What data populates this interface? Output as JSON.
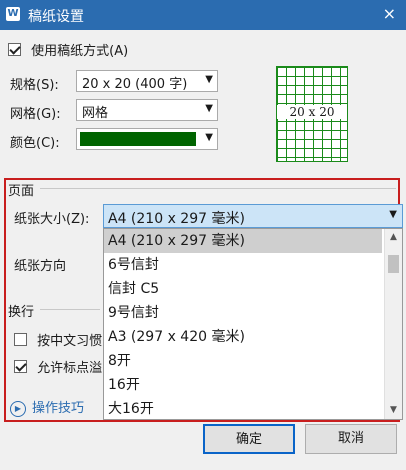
{
  "window": {
    "title": "稿纸设置",
    "app_icon": "W",
    "close_glyph": "×"
  },
  "use_grid": {
    "label": "使用稿纸方式(A)",
    "checked": true
  },
  "spec": {
    "label": "规格(S):",
    "value": "20 x 20 (400 字)"
  },
  "grid": {
    "label": "网格(G):",
    "value": "网格"
  },
  "color": {
    "label": "颜色(C):",
    "value": "#006400"
  },
  "preview": {
    "text": "20 x 20",
    "line_color": "#1a8a1a"
  },
  "page": {
    "section_label": "页面",
    "paper_size_label": "纸张大小(Z):",
    "paper_size_value": "A4 (210 x 297 毫米)",
    "orientation_label": "纸张方向",
    "options": [
      "A4 (210 x 297 毫米)",
      "6号信封",
      "信封 C5",
      "9号信封",
      "A3 (297 x 420 毫米)",
      "8开",
      "16开",
      "大16开"
    ],
    "highlight_color": "#c81e1e"
  },
  "wrap": {
    "section_label": "换行",
    "opt1_label": "按中文习惯",
    "opt1_checked": false,
    "opt2_label": "允许标点溢",
    "opt2_checked": true
  },
  "tips": {
    "label": "操作技巧"
  },
  "buttons": {
    "ok": "确定",
    "cancel": "取消"
  },
  "icons": {
    "dropdown": "chevron-down-icon",
    "scroll_up": "chevron-up-icon",
    "scroll_down": "chevron-down-icon",
    "tips": "play-circle-icon"
  }
}
